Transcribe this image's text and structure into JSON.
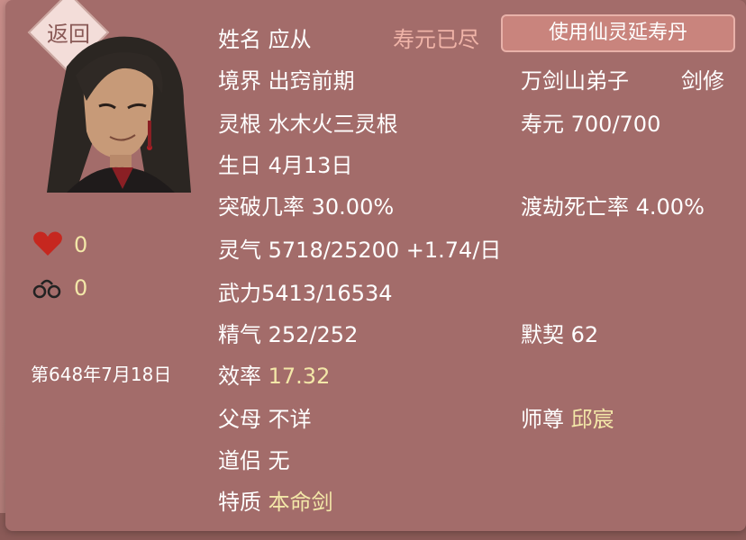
{
  "header": {
    "back_label": "返回",
    "lifespan_status": "寿元已尽",
    "use_button_label": "使用仙灵延寿丹"
  },
  "side": {
    "favor_value": "0",
    "bond_value": "0",
    "date": "第648年7月18日"
  },
  "info": {
    "name_label": "姓名",
    "name_value": "应从",
    "realm_label": "境界",
    "realm_value": "出窍前期",
    "root_label": "灵根",
    "root_value": "水木火三灵根",
    "birthday_label": "生日",
    "birthday_value": "4月13日",
    "breakthrough_label": "突破几率",
    "breakthrough_value": "30.00%",
    "qi_label": "灵气",
    "qi_value": "5718/25200 +1.74/日",
    "force_label": "武力",
    "force_value": "5413/16534",
    "essence_label": "精气",
    "essence_value": "252/252",
    "efficiency_label": "效率",
    "efficiency_value": "17.32",
    "parents_label": "父母",
    "parents_value": "不详",
    "partner_label": "道侣",
    "partner_value": "无",
    "trait_label": "特质",
    "trait_value": "本命剑"
  },
  "right": {
    "sect": "万剑山弟子",
    "class": "剑修",
    "lifespan_label": "寿元",
    "lifespan_value": "700/700",
    "tribulation_label": "渡劫死亡率",
    "tribulation_value": "4.00%",
    "tacit_label": "默契",
    "tacit_value": "62",
    "master_label": "师尊",
    "master_value": "邱宸"
  },
  "colors": {
    "panel": "#a36c6a",
    "highlight": "#f3e7a8",
    "button": "#c9847d"
  }
}
